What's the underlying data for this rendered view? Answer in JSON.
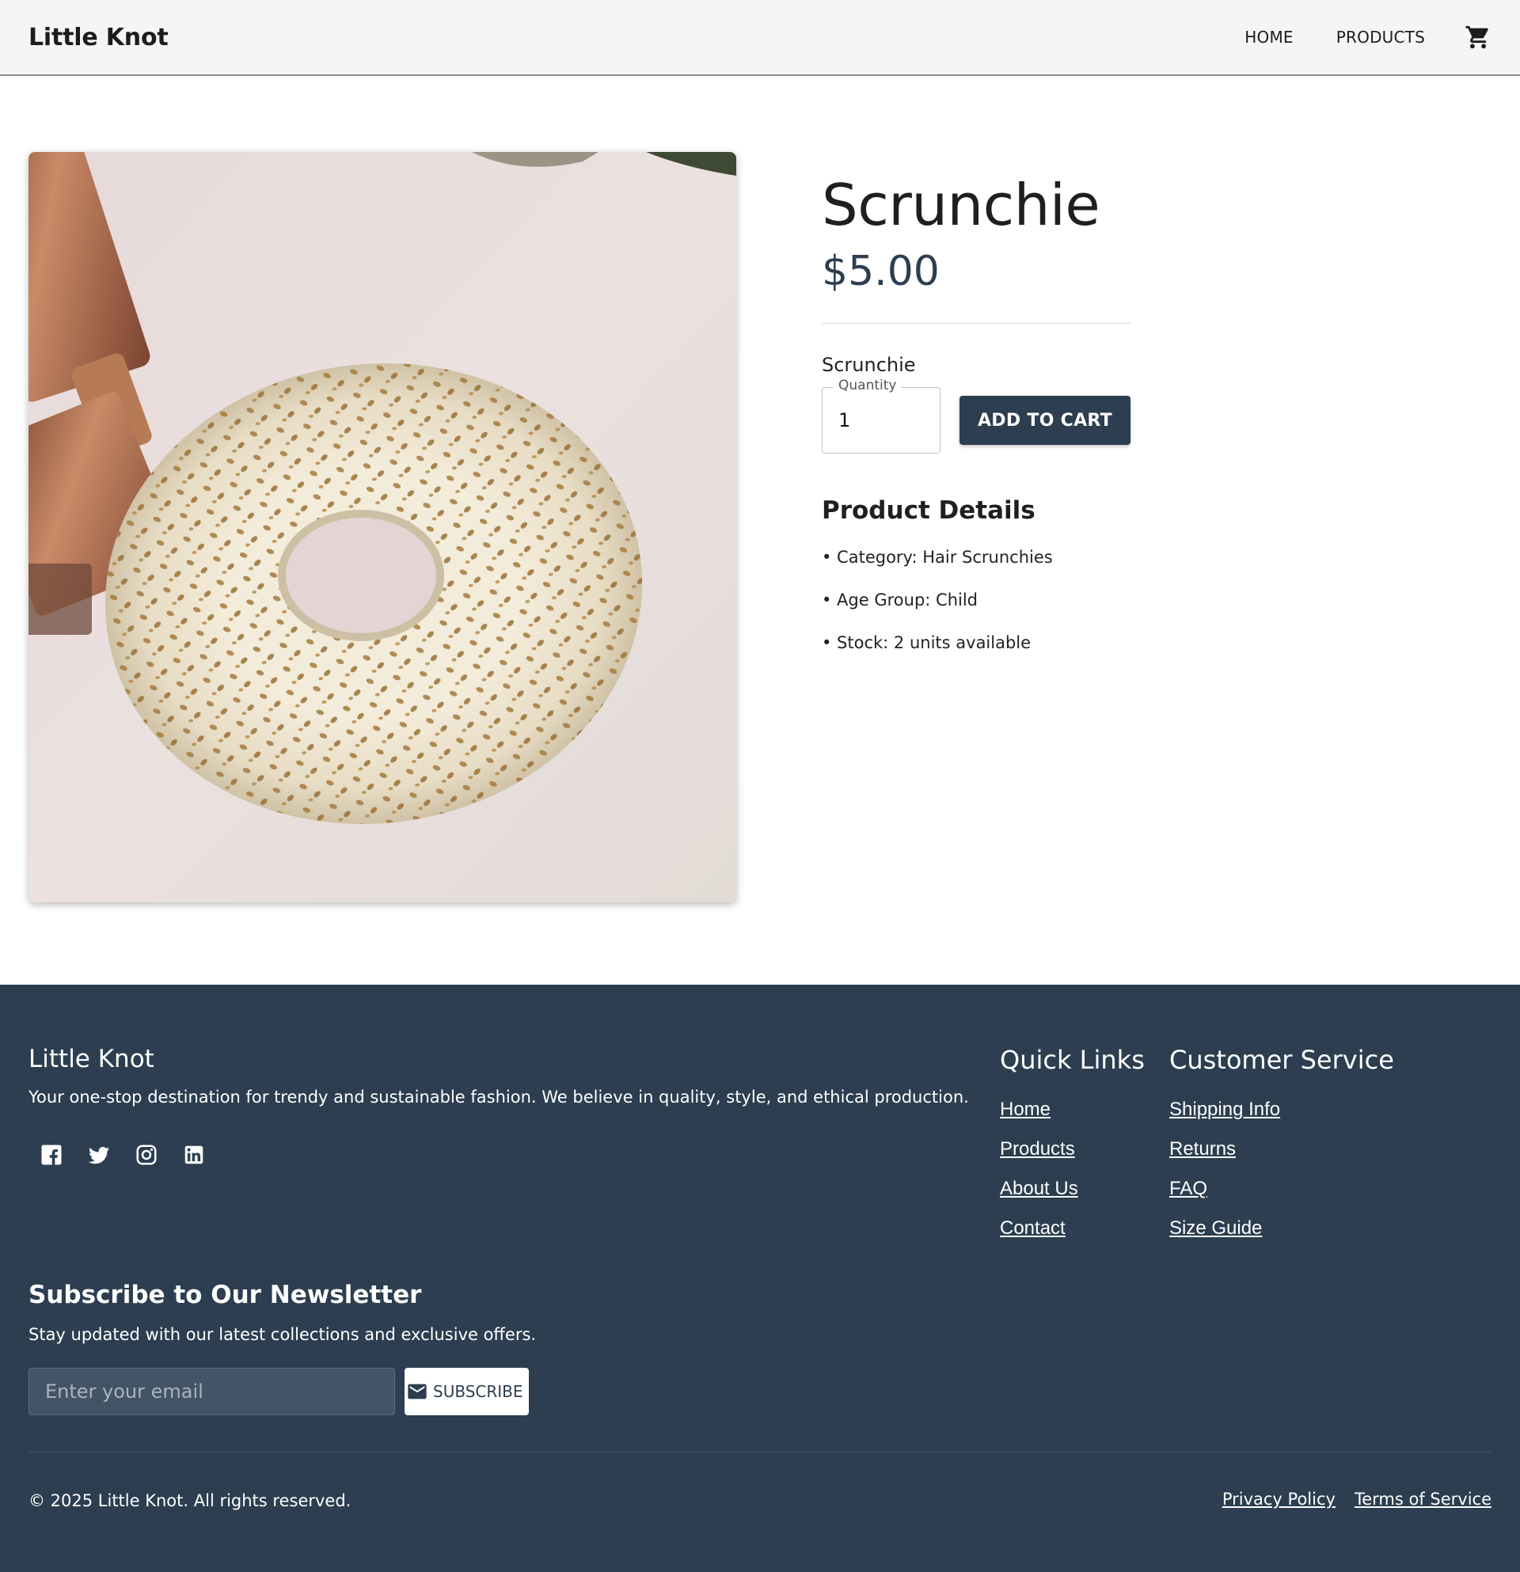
{
  "header": {
    "brand": "Little Knot",
    "nav": [
      "HOME",
      "PRODUCTS"
    ],
    "cart_icon": "shopping-cart-icon"
  },
  "product": {
    "image_icon": "scrunchie-photo",
    "title": "Scrunchie",
    "price": "$5.00",
    "variant": "Scrunchie",
    "quantity_label": "Quantity",
    "quantity_value": "1",
    "add_to_cart": "ADD TO CART",
    "details_title": "Product Details",
    "details": [
      "• Category: Hair Scrunchies",
      "• Age Group: Child",
      "• Stock: 2 units available"
    ]
  },
  "footer": {
    "brand": "Little Knot",
    "description": "Your one-stop destination for trendy and sustainable fashion. We believe in quality, style, and ethical production.",
    "socials": [
      "facebook-icon",
      "twitter-icon",
      "instagram-icon",
      "linkedin-icon"
    ],
    "quick_links": {
      "title": "Quick Links",
      "items": [
        "Home",
        "Products",
        "About Us",
        "Contact"
      ]
    },
    "customer_service": {
      "title": "Customer Service",
      "items": [
        "Shipping Info",
        "Returns",
        "FAQ",
        "Size Guide"
      ]
    },
    "newsletter": {
      "title": "Subscribe to Our Newsletter",
      "description": "Stay updated with our latest collections and exclusive offers.",
      "placeholder": "Enter your email",
      "button": "SUBSCRIBE"
    },
    "copyright": "© 2025 Little Knot. All rights reserved.",
    "legal": [
      "Privacy Policy",
      "Terms of Service"
    ]
  },
  "colors": {
    "primary": "#2c3e50",
    "header_bg": "#f5f5f5",
    "footer_bg": "#2c3e50"
  }
}
